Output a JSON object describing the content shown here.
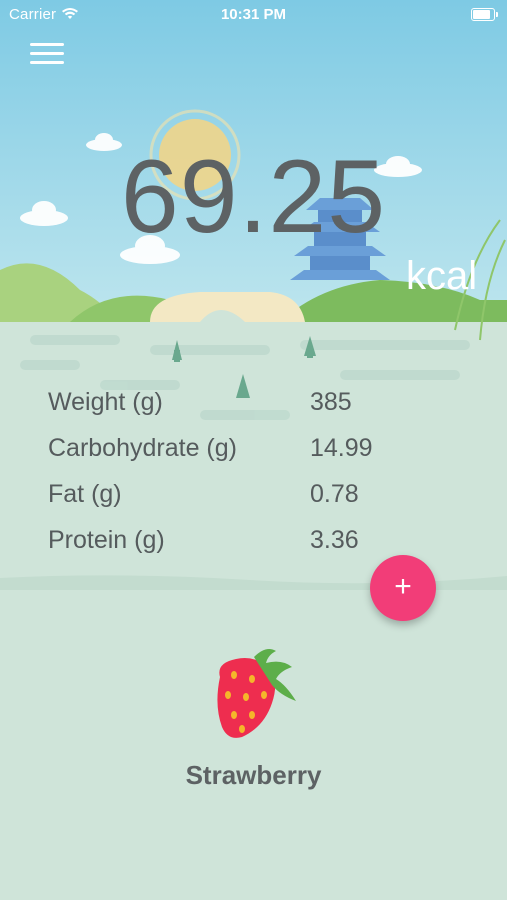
{
  "status_bar": {
    "carrier": "Carrier",
    "time": "10:31 PM",
    "battery_level": 0.95
  },
  "calories": {
    "value": "69.25",
    "unit": "kcal"
  },
  "nutrition": [
    {
      "label": "Weight (g)",
      "value": "385"
    },
    {
      "label": "Carbohydrate (g)",
      "value": "14.99"
    },
    {
      "label": "Fat (g)",
      "value": "0.78"
    },
    {
      "label": "Protein (g)",
      "value": "3.36"
    }
  ],
  "add_button": {
    "label": "+"
  },
  "food": {
    "name": "Strawberry",
    "icon": "strawberry-icon"
  },
  "colors": {
    "accent": "#f23d78",
    "text": "#5d6264",
    "background": "#cfe4d9",
    "sky": "#8fd3e8"
  }
}
